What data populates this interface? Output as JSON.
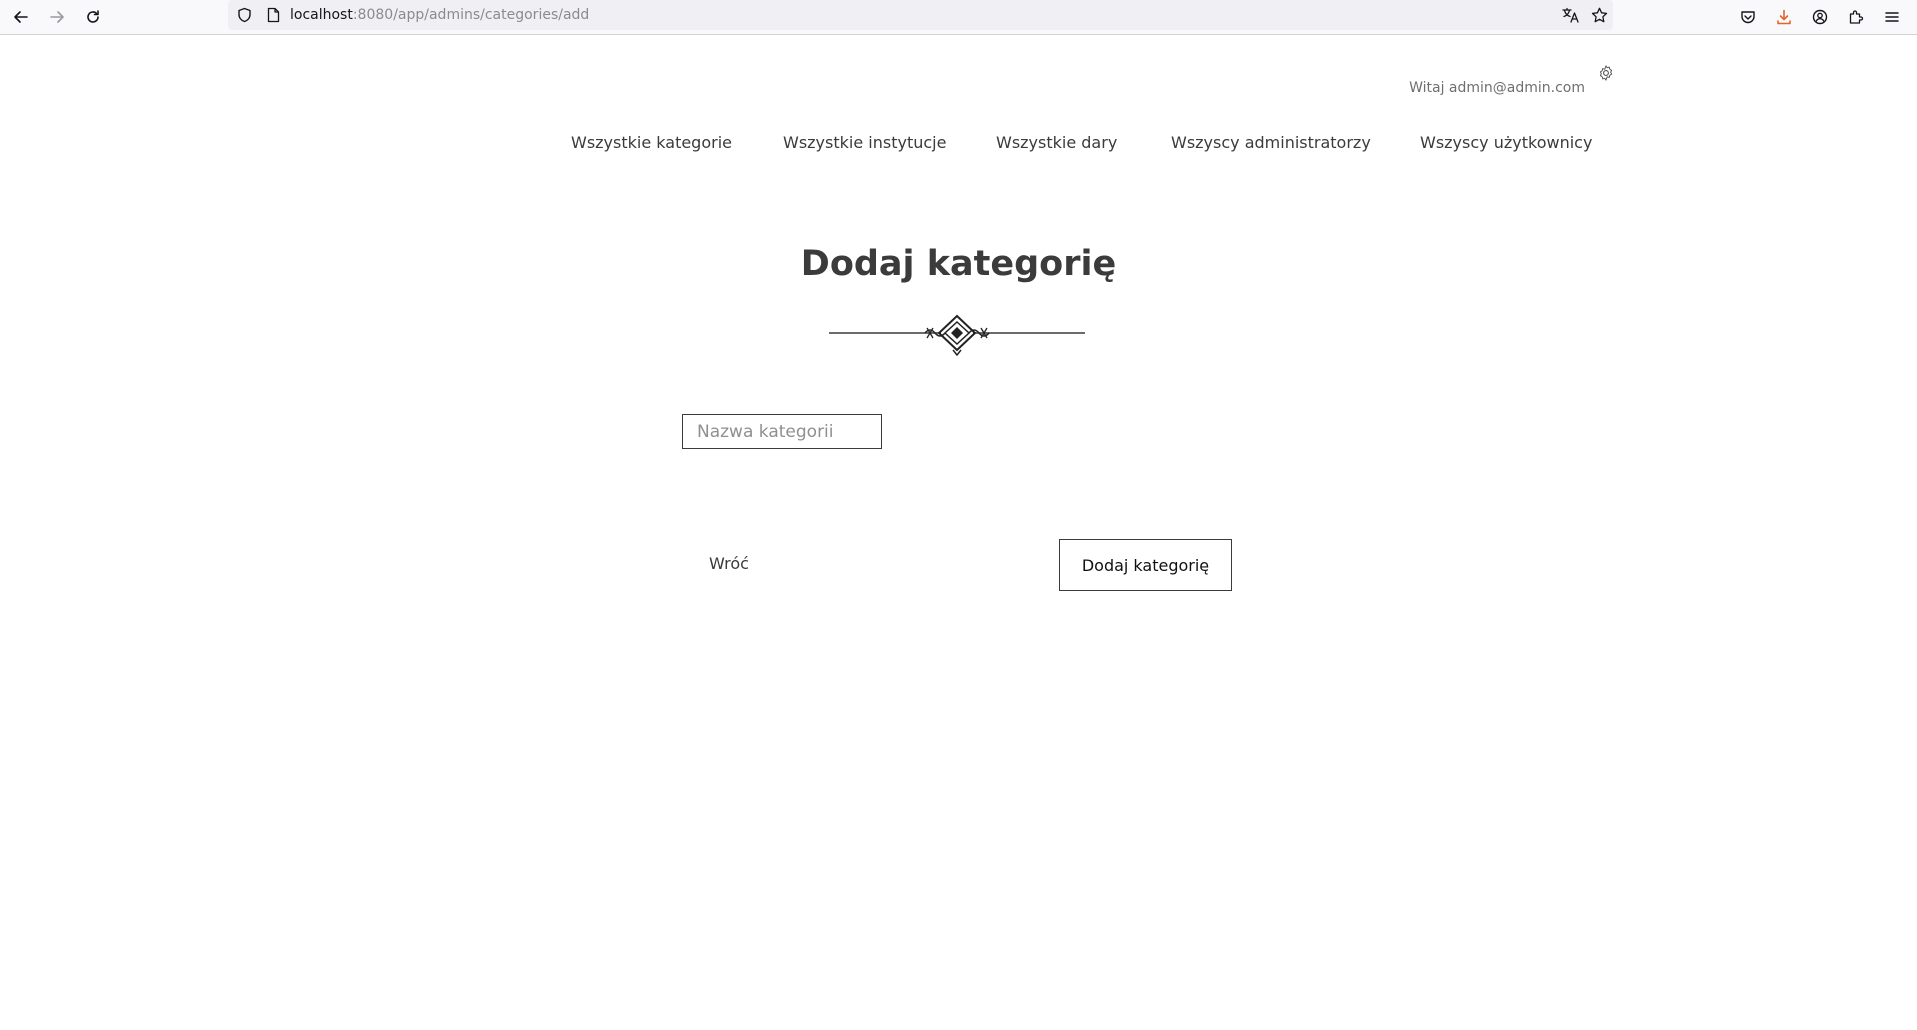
{
  "browser": {
    "url_host": "localhost",
    "url_path": ":8080/app/admins/categories/add",
    "icons": {
      "back": "arrow-left-icon",
      "forward": "arrow-right-icon",
      "reload": "reload-icon",
      "shield": "shield-icon",
      "page": "page-icon",
      "translate": "translate-icon",
      "bookmark": "star-icon",
      "pocket": "pocket-icon",
      "downloads": "download-icon",
      "account": "account-icon",
      "extensions": "puzzle-icon",
      "menu": "hamburger-menu-icon"
    },
    "download_color": "#e2652c"
  },
  "header": {
    "greeting": "Witaj admin@admin.com",
    "settings_icon": "gear-icon"
  },
  "nav": {
    "items": [
      {
        "label": "Wszystkie kategorie"
      },
      {
        "label": "Wszystkie instytucje"
      },
      {
        "label": "Wszystkie dary"
      },
      {
        "label": "Wszyscy administratorzy"
      },
      {
        "label": "Wszyscy użytkownicy"
      }
    ]
  },
  "main": {
    "title": "Dodaj kategorię",
    "ornament_icon": "decorative-divider-icon",
    "category_name_placeholder": "Nazwa kategorii",
    "category_name_value": "",
    "back_label": "Wróć",
    "submit_label": "Dodaj kategorię"
  }
}
